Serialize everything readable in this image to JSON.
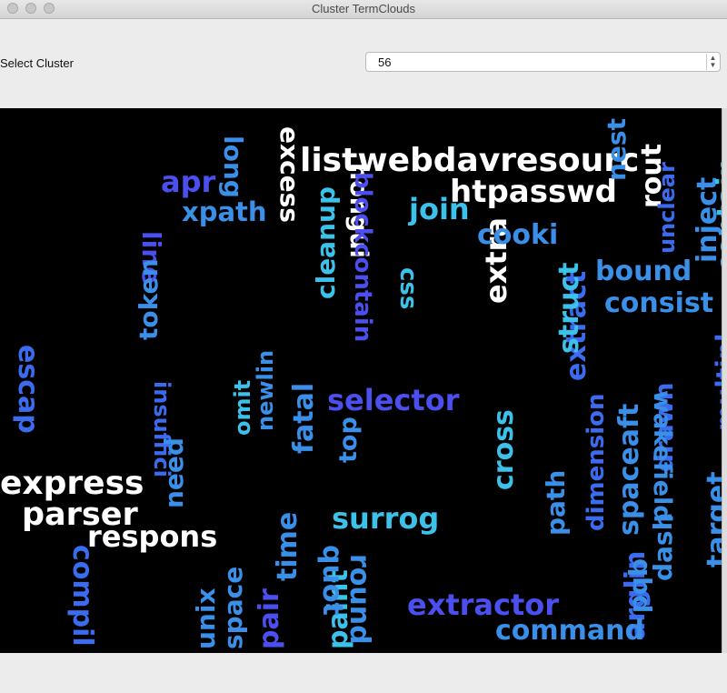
{
  "window": {
    "title": "Cluster TermClouds"
  },
  "controls": {
    "select_label": "Select Cluster",
    "selected_cluster": "56"
  },
  "colors": {
    "background": "#000000",
    "white": "#ffffff",
    "sky": "#3cc2ea",
    "azure": "#3a8fe8",
    "blue": "#3b6cf0",
    "indigo": "#4b4ff0"
  },
  "cloud": {
    "words": [
      {
        "text": "listwebdavresourc",
        "color": "white"
      },
      {
        "text": "htpasswd",
        "color": "white"
      },
      {
        "text": "excess",
        "color": "white"
      },
      {
        "text": "nongui",
        "color": "white"
      },
      {
        "text": "extra",
        "color": "white"
      },
      {
        "text": "express",
        "color": "white"
      },
      {
        "text": "parser",
        "color": "white"
      },
      {
        "text": "respons",
        "color": "white"
      },
      {
        "text": "rout",
        "color": "white"
      },
      {
        "text": "apr",
        "color": "indigo"
      },
      {
        "text": "long",
        "color": "azure"
      },
      {
        "text": "xpath",
        "color": "azure"
      },
      {
        "text": "cleanup",
        "color": "sky"
      },
      {
        "text": "blockcontain",
        "color": "indigo"
      },
      {
        "text": "css",
        "color": "sky"
      },
      {
        "text": "join",
        "color": "sky"
      },
      {
        "text": "cooki",
        "color": "azure"
      },
      {
        "text": "nest",
        "color": "azure"
      },
      {
        "text": "unclear",
        "color": "blue"
      },
      {
        "text": "inject",
        "color": "azure"
      },
      {
        "text": "contain",
        "color": "sky"
      },
      {
        "text": "line",
        "color": "indigo"
      },
      {
        "text": "token",
        "color": "azure"
      },
      {
        "text": "extract",
        "color": "blue"
      },
      {
        "text": "struct",
        "color": "sky"
      },
      {
        "text": "bound",
        "color": "azure"
      },
      {
        "text": "consist",
        "color": "azure"
      },
      {
        "text": "escap",
        "color": "blue"
      },
      {
        "text": "omit",
        "color": "sky"
      },
      {
        "text": "newlin",
        "color": "azure"
      },
      {
        "text": "insuffici",
        "color": "blue"
      },
      {
        "text": "fatal",
        "color": "azure"
      },
      {
        "text": "selector",
        "color": "indigo"
      },
      {
        "text": "cross",
        "color": "sky"
      },
      {
        "text": "dimension",
        "color": "blue"
      },
      {
        "text": "spaceaft",
        "color": "azure"
      },
      {
        "text": "drawn",
        "color": "blue"
      },
      {
        "text": "multipl",
        "color": "blue"
      },
      {
        "text": "top",
        "color": "azure"
      },
      {
        "text": "need",
        "color": "azure"
      },
      {
        "text": "path",
        "color": "azure"
      },
      {
        "text": "wakefield",
        "color": "azure"
      },
      {
        "text": "surrog",
        "color": "sky"
      },
      {
        "text": "arglin",
        "color": "blue"
      },
      {
        "text": "target",
        "color": "azure"
      },
      {
        "text": "dash",
        "color": "azure"
      },
      {
        "text": "qbd",
        "color": "azure"
      },
      {
        "text": "compil",
        "color": "blue"
      },
      {
        "text": "unix",
        "color": "azure"
      },
      {
        "text": "space",
        "color": "azure"
      },
      {
        "text": "pair",
        "color": "indigo"
      },
      {
        "text": "time",
        "color": "azure"
      },
      {
        "text": "paint",
        "color": "sky"
      },
      {
        "text": "quot",
        "color": "azure"
      },
      {
        "text": "round",
        "color": "azure"
      },
      {
        "text": "extractor",
        "color": "indigo"
      },
      {
        "text": "command",
        "color": "azure"
      }
    ]
  }
}
